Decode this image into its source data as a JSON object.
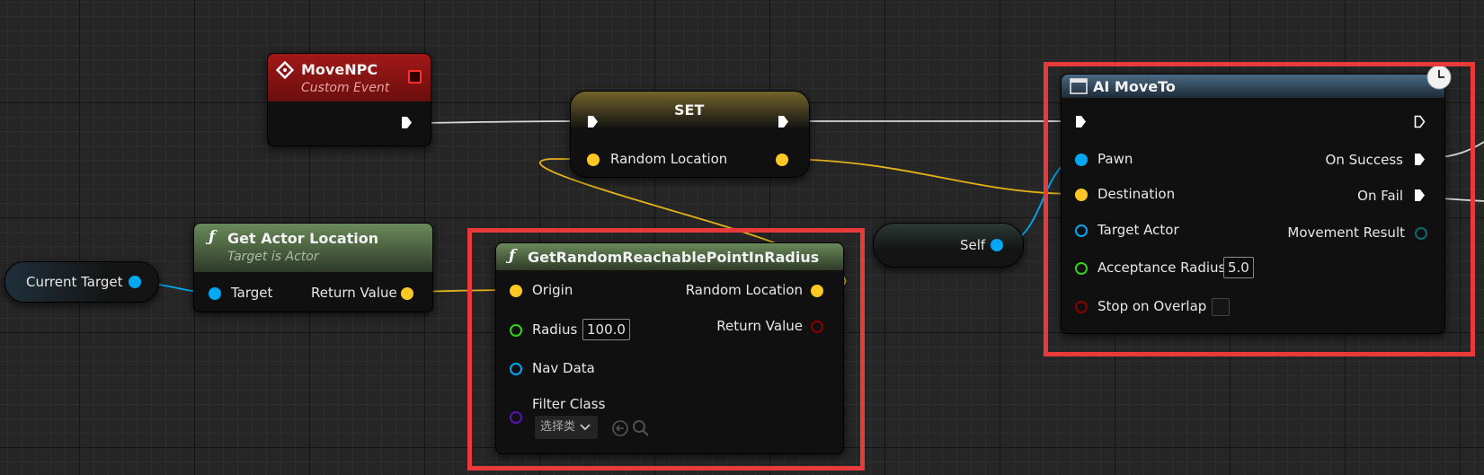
{
  "colors": {
    "event_header": "#7a1010",
    "function_header": "#56714a",
    "set_header": "#6b5a14",
    "ai_header": "#2e4456",
    "object_pin": "#00a8f4",
    "vector_pin": "#fdc823",
    "float_pin": "#35d11d",
    "bool_pin": "#8b0000",
    "class_pin": "#5b0fb7",
    "highlight": "#e83a3a"
  },
  "nodes": {
    "move_npc": {
      "title": "MoveNPC",
      "subtitle": "Custom Event",
      "icon": "event-diamond-icon"
    },
    "set": {
      "title": "SET",
      "var_label": "Random Location"
    },
    "current_target": {
      "label": "Current Target"
    },
    "get_actor_location": {
      "title": "Get Actor Location",
      "subtitle": "Target is Actor",
      "icon": "function-icon",
      "pin_target": "Target",
      "pin_return": "Return Value"
    },
    "get_random_point": {
      "title": "GetRandomReachablePointInRadius",
      "icon": "function-icon",
      "pin_origin": "Origin",
      "pin_radius": "Radius",
      "radius_value": "100.0",
      "pin_nav_data": "Nav Data",
      "pin_filter_class": "Filter Class",
      "filter_dropdown": "选择类",
      "pin_random_location": "Random Location",
      "pin_return_value": "Return Value"
    },
    "self": {
      "label": "Self"
    },
    "ai_move_to": {
      "title": "AI MoveTo",
      "icon": "window-icon",
      "pin_pawn": "Pawn",
      "pin_destination": "Destination",
      "pin_target_actor": "Target Actor",
      "pin_acceptance_radius": "Acceptance Radius",
      "acceptance_value": "5.0",
      "pin_stop_on_overlap": "Stop on Overlap",
      "pin_on_success": "On Success",
      "pin_on_fail": "On Fail",
      "pin_movement_result": "Movement Result",
      "latent_icon": "clock-icon"
    }
  }
}
